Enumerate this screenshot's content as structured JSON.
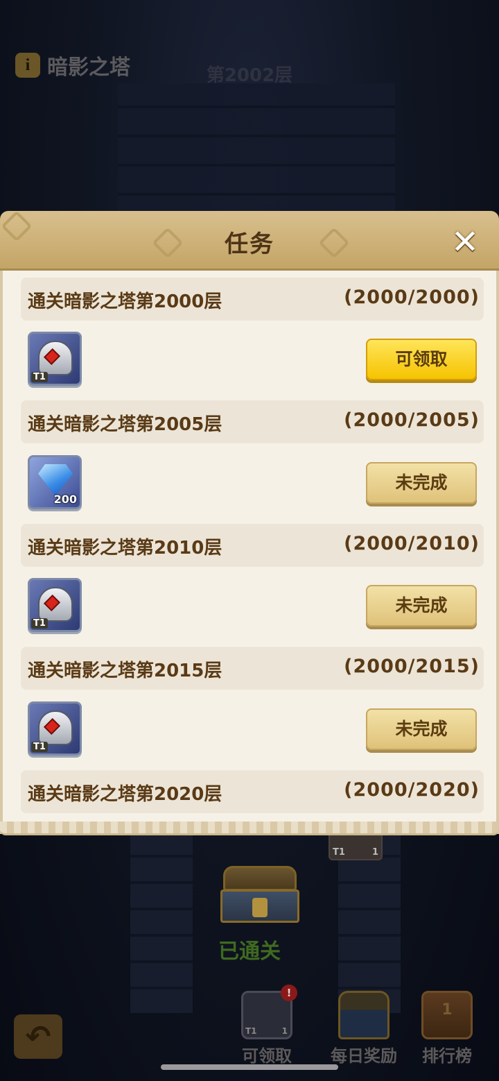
{
  "background": {
    "title": "暗影之塔",
    "info_icon": "i",
    "floor": "第2002层",
    "reward_tier": "T1",
    "reward_count": "1",
    "cleared": "已通关"
  },
  "modal": {
    "title": "任务",
    "close": "✕",
    "tasks": [
      {
        "name": "通关暗影之塔第2000层",
        "progress": "(2000/2000)",
        "reward": {
          "type": "helm-icon",
          "tag": "T1"
        },
        "button": "可领取",
        "button_state": "claimable"
      },
      {
        "name": "通关暗影之塔第2005层",
        "progress": "(2000/2005)",
        "reward": {
          "type": "gem-icon",
          "tag": "200"
        },
        "button": "未完成",
        "button_state": "incomplete"
      },
      {
        "name": "通关暗影之塔第2010层",
        "progress": "(2000/2010)",
        "reward": {
          "type": "helm-icon",
          "tag": "T1"
        },
        "button": "未完成",
        "button_state": "incomplete"
      },
      {
        "name": "通关暗影之塔第2015层",
        "progress": "(2000/2015)",
        "reward": {
          "type": "helm-icon",
          "tag": "T1"
        },
        "button": "未完成",
        "button_state": "incomplete"
      },
      {
        "name": "通关暗影之塔第2020层",
        "progress": "(2000/2020)"
      }
    ]
  },
  "nav": {
    "back_icon": "↶",
    "items": [
      {
        "label": "可领取",
        "icon": "helm-icon",
        "badge": "!",
        "tier": "T1",
        "count": "1"
      },
      {
        "label": "每日奖励",
        "icon": "chest-icon"
      },
      {
        "label": "排行榜",
        "icon": "trophy-icon",
        "rank": "1"
      }
    ]
  },
  "colors": {
    "header": "#c4a567",
    "body": "#f6f1e7",
    "row": "#ece5d7",
    "text": "#5a3a16",
    "claim_button": "#f5c300",
    "incomplete_button": "#dfc27a"
  }
}
